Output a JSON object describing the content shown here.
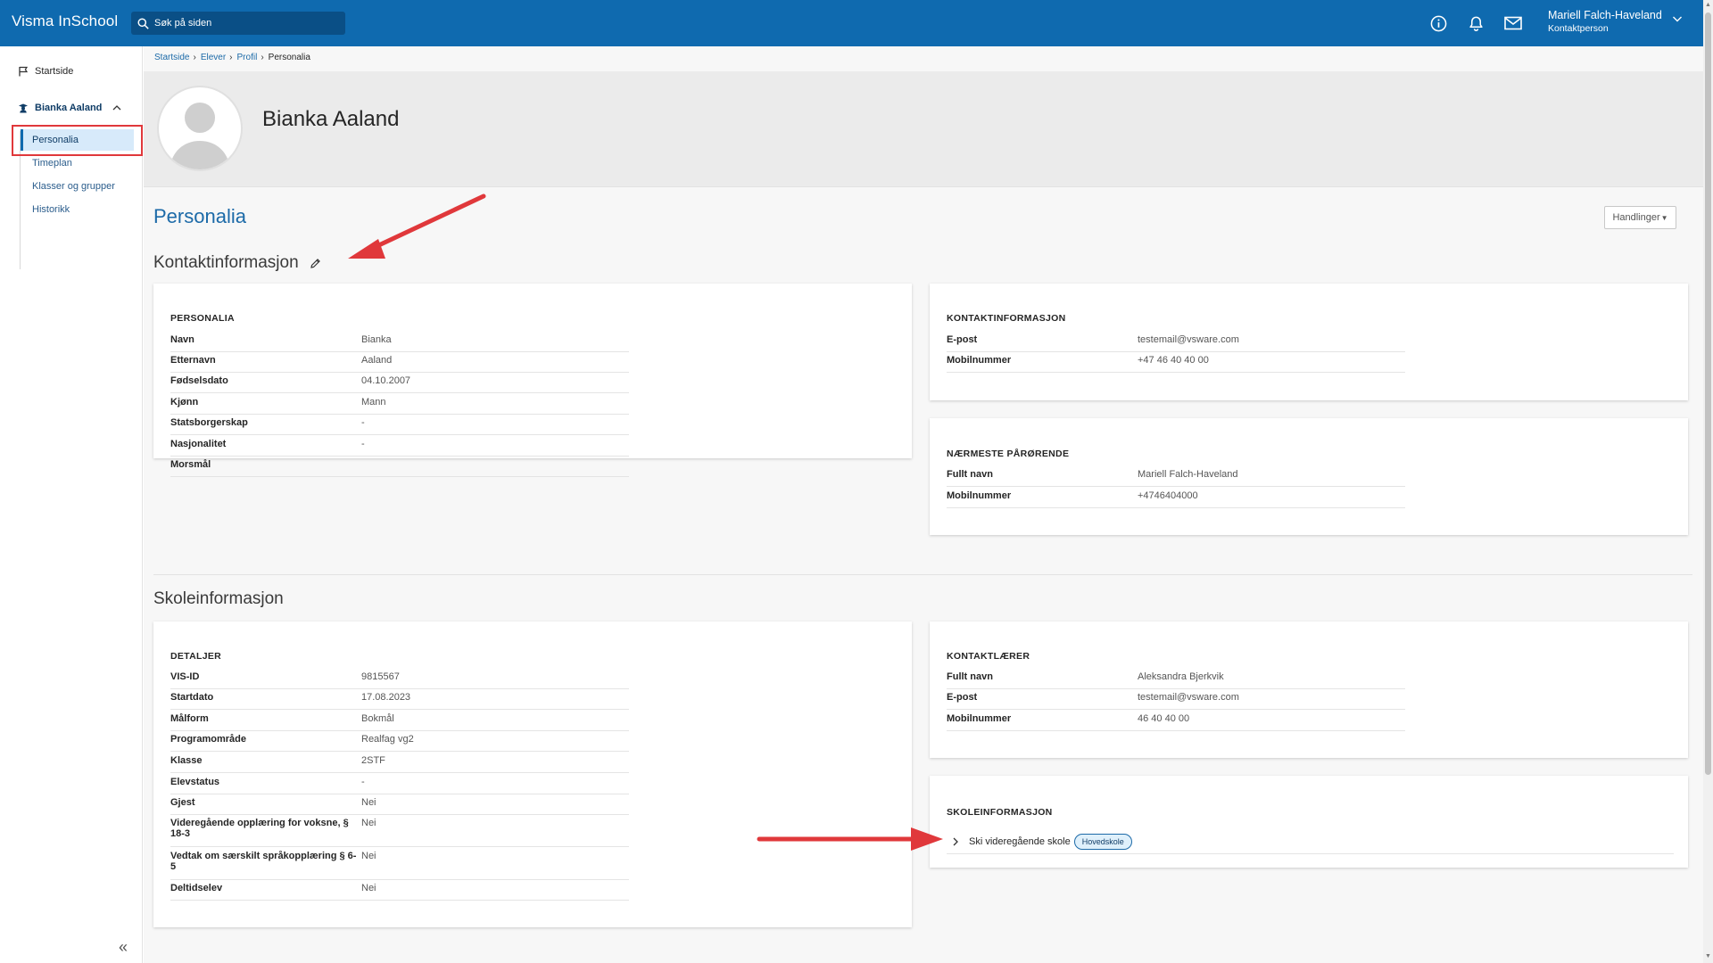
{
  "app": {
    "brand": "Visma InSchool",
    "search_placeholder": "Søk på siden",
    "user": {
      "name": "Mariell Falch-Haveland",
      "role": "Kontaktperson"
    },
    "icons": [
      "info-icon",
      "bell-icon",
      "mail-icon"
    ]
  },
  "sidebar": {
    "start": "Startside",
    "student": "Bianka Aaland",
    "items": [
      {
        "label": "Personalia",
        "active": true
      },
      {
        "label": "Timeplan",
        "active": false
      },
      {
        "label": "Klasser og grupper",
        "active": false
      },
      {
        "label": "Historikk",
        "active": false
      }
    ]
  },
  "breadcrumb": [
    "Startside",
    "Elever",
    "Profil",
    "Personalia"
  ],
  "profile": {
    "name": "Bianka Aaland"
  },
  "page": {
    "title": "Personalia",
    "actions_label": "Handlinger",
    "contact_heading": "Kontaktinformasjon",
    "school_heading": "Skoleinformasjon"
  },
  "cards": {
    "personalia": {
      "title": "PERSONALIA",
      "rows": [
        {
          "k": "Navn",
          "v": "Bianka"
        },
        {
          "k": "Etternavn",
          "v": "Aaland"
        },
        {
          "k": "Fødselsdato",
          "v": "04.10.2007"
        },
        {
          "k": "Kjønn",
          "v": "Mann"
        },
        {
          "k": "Statsborgerskap",
          "v": "-"
        },
        {
          "k": "Nasjonalitet",
          "v": "-"
        },
        {
          "k": "Morsmål",
          "v": ""
        }
      ]
    },
    "kontakt": {
      "title": "KONTAKTINFORMASJON",
      "rows": [
        {
          "k": "E-post",
          "v": "testemail@vsware.com"
        },
        {
          "k": "Mobilnummer",
          "v": "+47 46 40 40 00"
        }
      ]
    },
    "parorende": {
      "title": "NÆRMESTE PÅRØRENDE",
      "rows": [
        {
          "k": "Fullt navn",
          "v": "Mariell Falch-Haveland"
        },
        {
          "k": "Mobilnummer",
          "v": "+4746404000"
        }
      ]
    },
    "detaljer": {
      "title": "DETALJER",
      "rows": [
        {
          "k": "VIS-ID",
          "v": "9815567"
        },
        {
          "k": "Startdato",
          "v": "17.08.2023"
        },
        {
          "k": "Målform",
          "v": "Bokmål"
        },
        {
          "k": "Programområde",
          "v": "Realfag vg2"
        },
        {
          "k": "Klasse",
          "v": "2STF"
        },
        {
          "k": "Elevstatus",
          "v": "-"
        },
        {
          "k": "Gjest",
          "v": "Nei"
        },
        {
          "k": "Videregående opplæring for voksne, § 18-3",
          "v": "Nei"
        },
        {
          "k": "Vedtak om særskilt språkopplæring § 6-5",
          "v": "Nei"
        },
        {
          "k": "Deltidselev",
          "v": "Nei"
        }
      ]
    },
    "kontaktlaerer": {
      "title": "KONTAKTLÆRER",
      "rows": [
        {
          "k": "Fullt navn",
          "v": "Aleksandra Bjerkvik"
        },
        {
          "k": "E-post",
          "v": "testemail@vsware.com"
        },
        {
          "k": "Mobilnummer",
          "v": "46 40 40 00"
        }
      ]
    },
    "skoleinfo": {
      "title": "SKOLEINFORMASJON",
      "school": "Ski videregående skole",
      "badge": "Hovedskole"
    }
  },
  "colors": {
    "topbar": "#0f6aaf",
    "accent": "#1c6aa8",
    "annotation": "#e0383b"
  }
}
